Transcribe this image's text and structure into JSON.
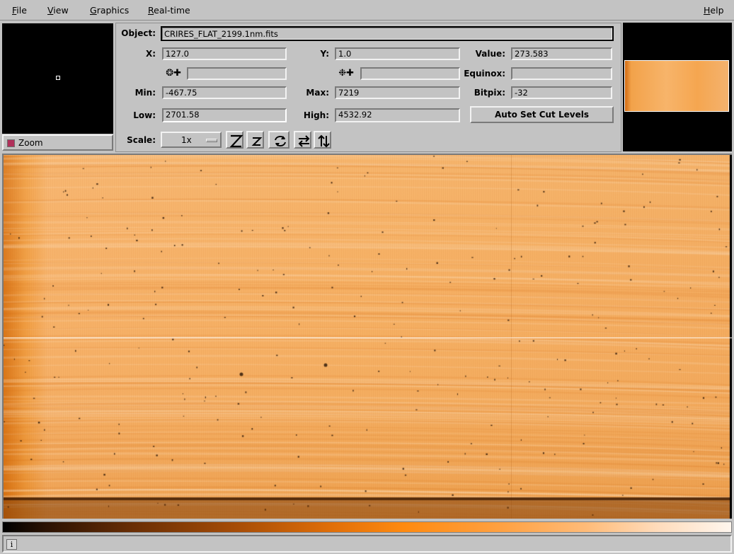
{
  "menubar": {
    "file": {
      "label": "File",
      "key": "F",
      "rest": "ile"
    },
    "view": {
      "label": "View",
      "key": "V",
      "rest": "iew"
    },
    "graphics": {
      "label": "Graphics",
      "key": "G",
      "rest": "raphics"
    },
    "realtime": {
      "label": "Real-time",
      "key": "R",
      "rest": "eal-time"
    },
    "help": {
      "label": "Help",
      "key": "H",
      "rest": "elp"
    }
  },
  "zoom": {
    "label": "Zoom"
  },
  "info": {
    "object_label": "Object:",
    "object_value": "CRIRES_FLAT_2199.1nm.fits",
    "x_label": "X:",
    "x_value": "127.0",
    "y_label": "Y:",
    "y_value": "1.0",
    "value_label": "Value:",
    "value_value": "273.583",
    "ra_symbol": "❂✚",
    "ra_value": "",
    "dec_symbol": "❉✚",
    "dec_value": "",
    "equinox_label": "Equinox:",
    "equinox_value": "",
    "min_label": "Min:",
    "min_value": "-467.75",
    "max_label": "Max:",
    "max_value": "7219",
    "bitpix_label": "Bitpix:",
    "bitpix_value": "-32",
    "low_label": "Low:",
    "low_value": "2701.58",
    "high_label": "High:",
    "high_value": "4532.92",
    "auto_cut_label": "Auto Set Cut Levels",
    "scale_label": "Scale:",
    "scale_value": "1x"
  },
  "toolbar_icons": [
    "zoom-in-icon",
    "zoom-out-icon",
    "rotate-icon",
    "flip-x-icon",
    "flip-y-icon"
  ],
  "status": {
    "text": ""
  },
  "colors": {
    "background": "#c3c3c3",
    "image_orange": "#f2a24a",
    "colormap": "heat"
  }
}
